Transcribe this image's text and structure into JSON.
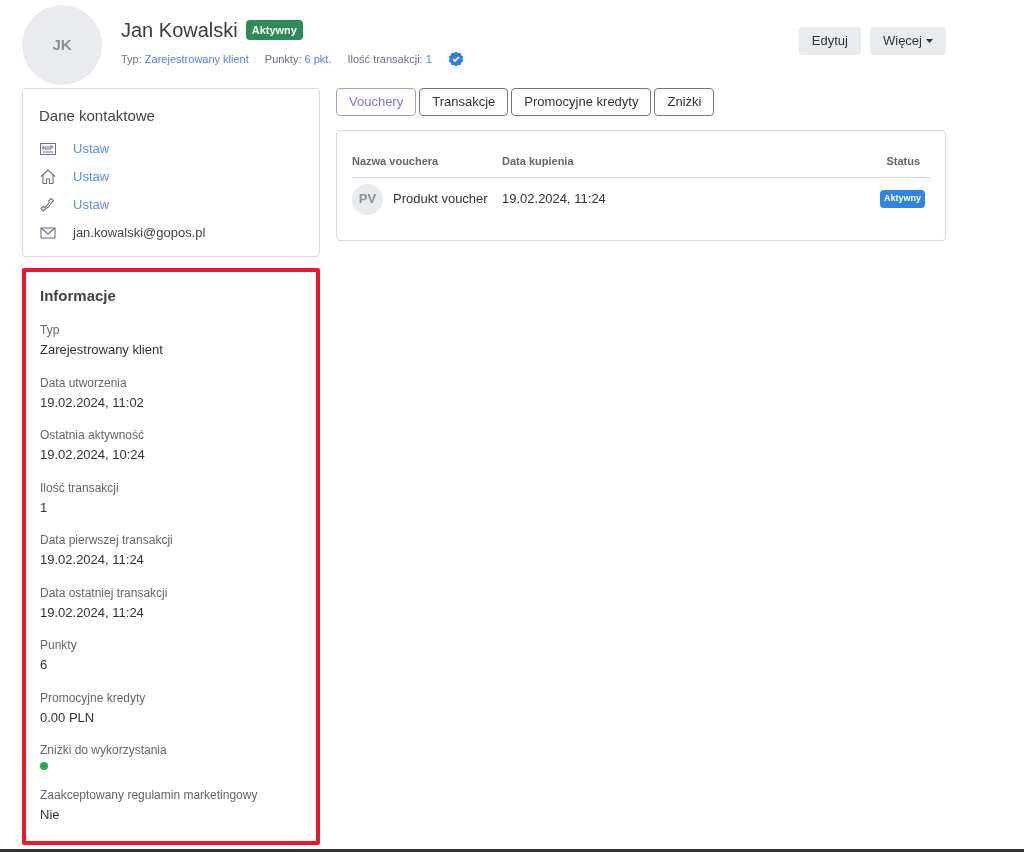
{
  "header": {
    "avatar_initials": "JK",
    "name": "Jan Kowalski",
    "status_badge": "Aktywny",
    "meta": [
      {
        "label": "Typ:",
        "value": "Zarejestrowany klient"
      },
      {
        "label": "Punkty:",
        "value": "6 pkt."
      },
      {
        "label": "Ilość transakcji:",
        "value": "1"
      }
    ],
    "verified": true,
    "buttons": [
      {
        "label": "Edytuj",
        "dropdown": false
      },
      {
        "label": "Więcej",
        "dropdown": true
      }
    ]
  },
  "contact": {
    "title": "Dane kontaktowe",
    "items": [
      {
        "kind": "nip",
        "text": "Ustaw",
        "is_link": true
      },
      {
        "kind": "home",
        "text": "Ustaw",
        "is_link": true
      },
      {
        "kind": "phone",
        "text": "Ustaw",
        "is_link": true
      },
      {
        "kind": "mail",
        "text": "jan.kowalski@gopos.pl",
        "is_link": false
      }
    ]
  },
  "info": {
    "title": "Informacje",
    "highlighted": true,
    "fields": [
      {
        "kind": "text",
        "label": "Typ",
        "value": "Zarejestrowany klient"
      },
      {
        "kind": "text",
        "label": "Data utworzenia",
        "value": "19.02.2024, 11:02"
      },
      {
        "kind": "text",
        "label": "Ostatnia aktywność",
        "value": "19.02.2024, 10:24"
      },
      {
        "kind": "text",
        "label": "Ilość transakcji",
        "value": "1"
      },
      {
        "kind": "text",
        "label": "Data pierwszej transakcji",
        "value": "19.02.2024, 11:24"
      },
      {
        "kind": "text",
        "label": "Data ostatniej transakcji",
        "value": "19.02.2024, 11:24"
      },
      {
        "kind": "text",
        "label": "Punkty",
        "value": "6"
      },
      {
        "kind": "text",
        "label": "Promocyjne kredyty",
        "value": "0.00 PLN"
      },
      {
        "kind": "dot",
        "label": "Zniżki do wykorzystania",
        "color": "#28a745"
      },
      {
        "kind": "text",
        "label": "Zaakceptowany regulamin marketingowy",
        "value": "Nie"
      }
    ]
  },
  "tabs": [
    {
      "label": "Vouchery",
      "selected": true
    },
    {
      "label": "Transakcje",
      "selected": false
    },
    {
      "label": "Promocyjne kredyty",
      "selected": false
    },
    {
      "label": "Zniżki",
      "selected": false
    }
  ],
  "table": {
    "columns": [
      "Nazwa vouchera",
      "Data kupienia",
      "Status"
    ],
    "rows": [
      {
        "initials": "PV",
        "name": "Produkt voucher",
        "date": "19.02.2024, 11:24",
        "status": "Aktywny"
      }
    ]
  }
}
